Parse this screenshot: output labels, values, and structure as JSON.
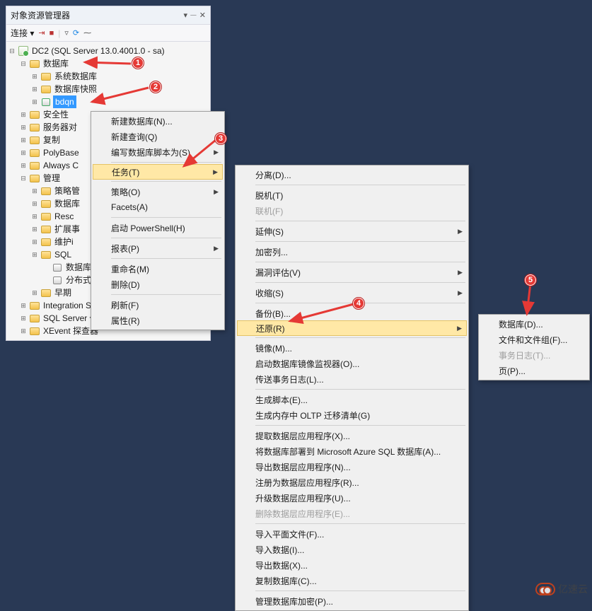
{
  "panel": {
    "title": "对象资源管理器",
    "connect_label": "连接",
    "toolbar_icons": [
      "close-icon",
      "pin-icon",
      "dropdown-icon"
    ]
  },
  "tree": {
    "root": "DC2 (SQL Server 13.0.4001.0 - sa)",
    "nodes": {
      "databases": "数据库",
      "sys_db": "系统数据库",
      "snapshot": "数据库快照",
      "bdqn": "bdqn",
      "security": "安全性",
      "server_obj": "服务器对",
      "replication": "复制",
      "polybase": "PolyBase",
      "always": "Always C",
      "mgmt": "管理",
      "policy": "策略管",
      "data": "数据库",
      "resc": "Resc",
      "ext": "扩展事",
      "maint": "维护i",
      "sql": "SQL",
      "dbmail": "数据库",
      "dist": "分布式",
      "early": "早期",
      "is": "Integration Services 目录",
      "agent": "SQL Server 代理",
      "xevent": "XEvent 探查器"
    }
  },
  "menu1": {
    "new_db": "新建数据库(N)...",
    "new_query": "新建查询(Q)",
    "script_db": "编写数据库脚本为(S)",
    "tasks": "任务(T)",
    "policies": "策略(O)",
    "facets": "Facets(A)",
    "powershell": "启动 PowerShell(H)",
    "reports": "报表(P)",
    "rename": "重命名(M)",
    "delete": "删除(D)",
    "refresh": "刷新(F)",
    "properties": "属性(R)"
  },
  "menu2": {
    "detach": "分离(D)...",
    "offline": "脱机(T)",
    "online": "联机(F)",
    "extend": "延伸(S)",
    "encrypt": "加密列...",
    "vuln": "漏洞评估(V)",
    "shrink": "收缩(S)",
    "backup": "备份(B)...",
    "restore": "还原(R)",
    "mirror": "镜像(M)...",
    "mirror_mon": "启动数据库镜像监视器(O)...",
    "ship_log": "传送事务日志(L)...",
    "gen_scripts": "生成脚本(E)...",
    "oltp": "生成内存中 OLTP 迁移清单(G)",
    "extract_dac": "提取数据层应用程序(X)...",
    "deploy_azure": "将数据库部署到 Microsoft Azure SQL 数据库(A)...",
    "export_dac": "导出数据层应用程序(N)...",
    "register_dac": "注册为数据层应用程序(R)...",
    "upgrade_dac": "升级数据层应用程序(U)...",
    "delete_dac": "删除数据层应用程序(E)...",
    "import_flat": "导入平面文件(F)...",
    "import_data": "导入数据(I)...",
    "export_data": "导出数据(X)...",
    "copy_db": "复制数据库(C)...",
    "manage_enc": "管理数据库加密(P)..."
  },
  "menu3": {
    "database": "数据库(D)...",
    "files": "文件和文件组(F)...",
    "txlog": "事务日志(T)...",
    "page": "页(P)..."
  },
  "badges": {
    "b1": "1",
    "b2": "2",
    "b3": "3",
    "b4": "4",
    "b5": "5"
  },
  "watermark": "亿速云"
}
